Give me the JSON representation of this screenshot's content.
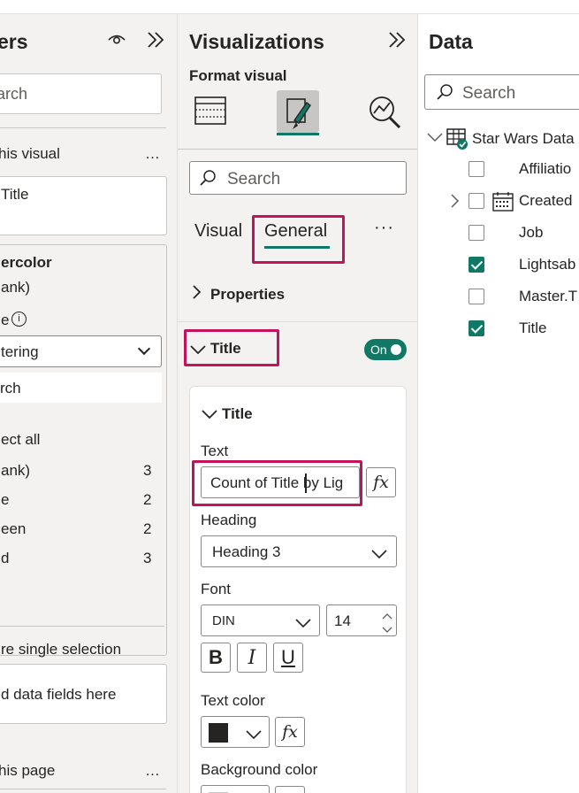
{
  "filters": {
    "title": "ers",
    "search_placeholder": "arch",
    "section_visual": "his visual",
    "more": "…",
    "filter_title_field": "Title",
    "card_field": "ercolor",
    "card_sub": "ank)",
    "filter_type_label": "e",
    "filter_type_value": "tering",
    "card_search": "rch",
    "select_all": "ect all",
    "items": [
      {
        "label": "ank)",
        "count": "3"
      },
      {
        "label": "e",
        "count": "2"
      },
      {
        "label": "een",
        "count": "2"
      },
      {
        "label": "d",
        "count": "3"
      }
    ],
    "require_single": "re single selection",
    "add_fields": "d data fields here",
    "section_page": "his page"
  },
  "viz": {
    "title": "Visualizations",
    "format_visual": "Format visual",
    "search_placeholder": "Search",
    "tab_visual": "Visual",
    "tab_general": "General",
    "more": "···",
    "properties": "Properties",
    "title_section": "Title",
    "toggle": "On",
    "card_title": "Title",
    "text_label": "Text",
    "text_value": "Count of Title by Lig",
    "fx": "fx",
    "heading_label": "Heading",
    "heading_value": "Heading 3",
    "font_label": "Font",
    "font_value": "DIN",
    "font_size": "14",
    "bold": "B",
    "italic": "I",
    "underline": "U",
    "text_color_label": "Text color",
    "text_color": "#252423",
    "bg_color_label": "Background color",
    "accent": "#117865",
    "highlight": "#c3135b"
  },
  "data": {
    "title": "Data",
    "search_placeholder": "Search",
    "table_name": "Star Wars Data",
    "fields": [
      {
        "label": "Affiliatio",
        "checked": false
      },
      {
        "label": "Created",
        "checked": false
      },
      {
        "label": "Job",
        "checked": false
      },
      {
        "label": "Lightsab",
        "checked": true
      },
      {
        "label": "Master.T",
        "checked": false
      },
      {
        "label": "Title",
        "checked": true
      }
    ]
  }
}
